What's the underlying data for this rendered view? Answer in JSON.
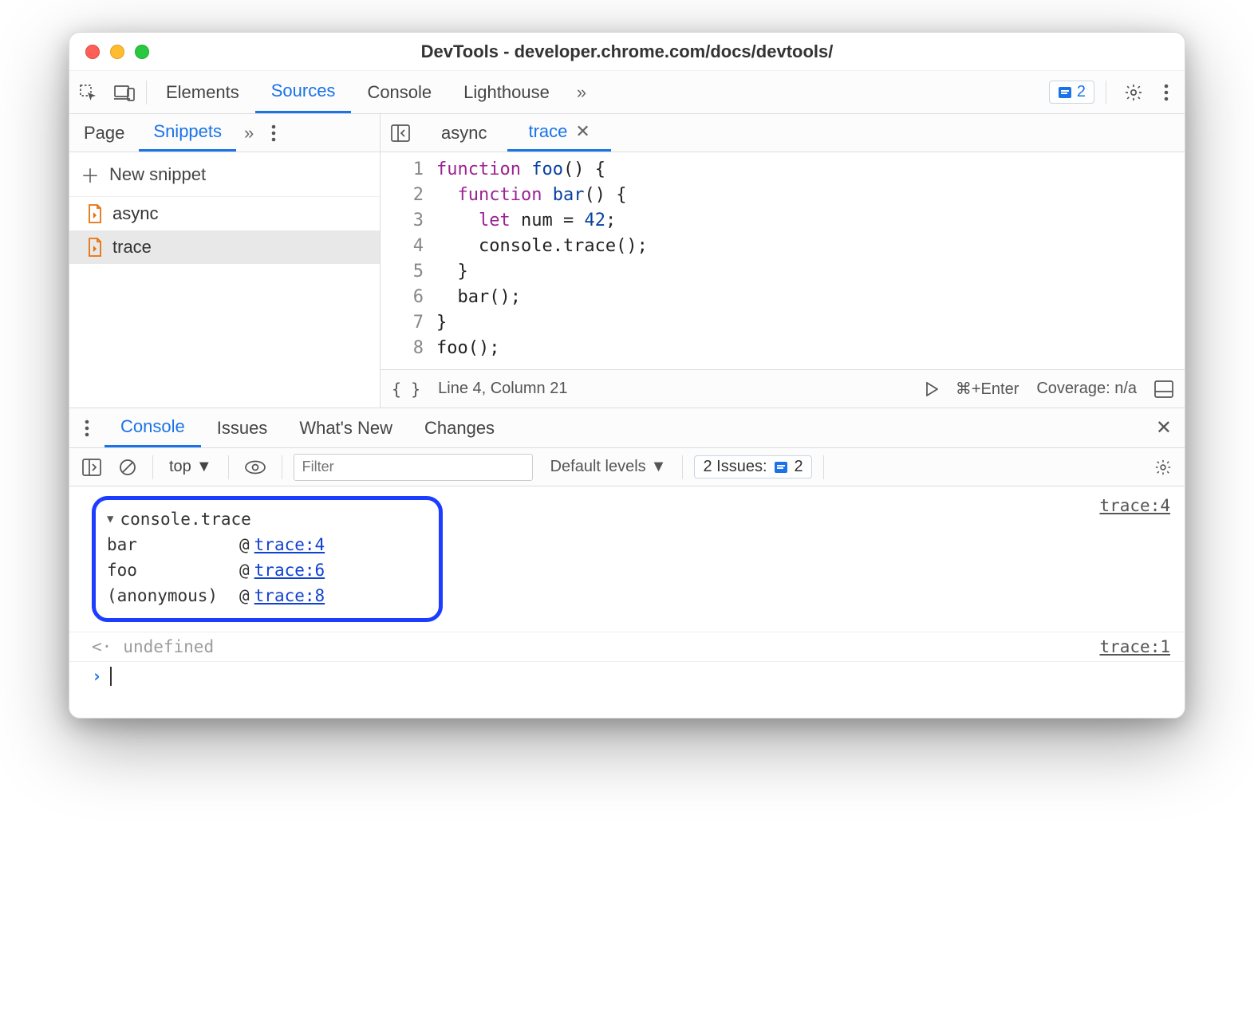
{
  "window": {
    "title": "DevTools - developer.chrome.com/docs/devtools/"
  },
  "toolbar": {
    "tabs": [
      "Elements",
      "Sources",
      "Console",
      "Lighthouse"
    ],
    "active_tab": "Sources",
    "issues_badge_count": "2"
  },
  "sidebar": {
    "tabs": [
      "Page",
      "Snippets"
    ],
    "active_tab": "Snippets",
    "new_snippet_label": "New snippet",
    "items": [
      {
        "name": "async",
        "selected": false
      },
      {
        "name": "trace",
        "selected": true
      }
    ]
  },
  "editor": {
    "tabs": [
      {
        "label": "async",
        "active": false,
        "closable": false
      },
      {
        "label": "trace",
        "active": true,
        "closable": true
      }
    ],
    "lines": [
      [
        {
          "t": "function ",
          "c": "kw"
        },
        {
          "t": "foo",
          "c": "fn"
        },
        {
          "t": "() {",
          "c": ""
        }
      ],
      [
        {
          "t": "  ",
          "c": ""
        },
        {
          "t": "function ",
          "c": "kw"
        },
        {
          "t": "bar",
          "c": "fn"
        },
        {
          "t": "() {",
          "c": ""
        }
      ],
      [
        {
          "t": "    ",
          "c": ""
        },
        {
          "t": "let ",
          "c": "kw"
        },
        {
          "t": "num = ",
          "c": ""
        },
        {
          "t": "42",
          "c": "num"
        },
        {
          "t": ";",
          "c": ""
        }
      ],
      [
        {
          "t": "    console.trace();",
          "c": ""
        }
      ],
      [
        {
          "t": "  }",
          "c": ""
        }
      ],
      [
        {
          "t": "  bar();",
          "c": ""
        }
      ],
      [
        {
          "t": "}",
          "c": ""
        }
      ],
      [
        {
          "t": "foo();",
          "c": ""
        }
      ]
    ],
    "status": {
      "cursor": "Line 4, Column 21",
      "run_hint": "⌘+Enter",
      "coverage": "Coverage: n/a"
    }
  },
  "drawer": {
    "tabs": [
      "Console",
      "Issues",
      "What's New",
      "Changes"
    ],
    "active_tab": "Console"
  },
  "console": {
    "context": "top",
    "filter_placeholder": "Filter",
    "levels": "Default levels",
    "issues_label": "2 Issues:",
    "issues_count": "2",
    "trace": {
      "header": "console.trace",
      "source": "trace:4",
      "stack": [
        {
          "fn": "bar",
          "at": "trace:4"
        },
        {
          "fn": "foo",
          "at": "trace:6"
        },
        {
          "fn": "(anonymous)",
          "at": "trace:8"
        }
      ]
    },
    "return_row": {
      "value": "undefined",
      "source": "trace:1"
    }
  }
}
